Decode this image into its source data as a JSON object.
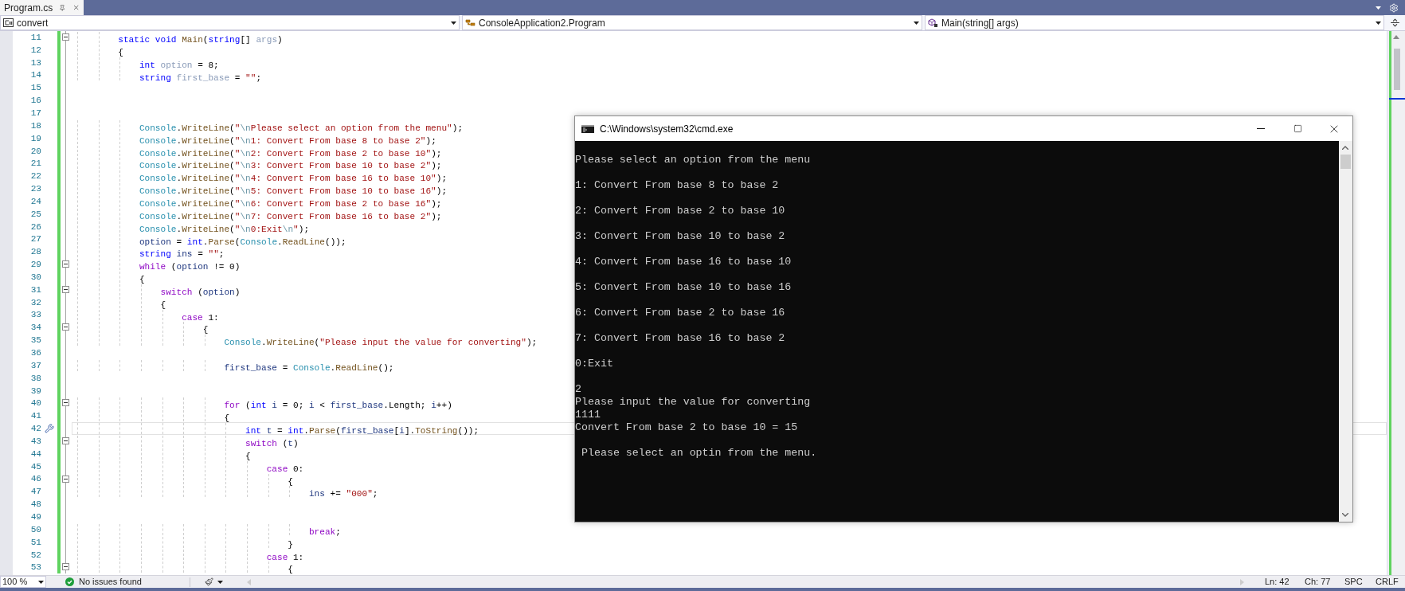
{
  "editor_tab": {
    "title": "Program.cs"
  },
  "nav_bar": {
    "project": "convert",
    "class": "ConsoleApplication2.Program",
    "member": "Main(string[] args)"
  },
  "code_lines": [
    {
      "number": "11",
      "changed": true,
      "fold": true,
      "current": false,
      "code": [
        {
          "text": "        static void ",
          "kind": "kw"
        },
        {
          "text": "Main",
          "kind": "method"
        },
        {
          "text": "(",
          "kind": "plain"
        },
        {
          "text": "string",
          "kind": "kw"
        },
        {
          "text": "[] ",
          "kind": "plain"
        },
        {
          "text": "args",
          "kind": "faded"
        },
        {
          "text": ")",
          "kind": "plain"
        }
      ]
    },
    {
      "number": "12",
      "changed": true,
      "fold": false,
      "current": false,
      "code": [
        {
          "text": "        {",
          "kind": "plain"
        }
      ]
    },
    {
      "number": "13",
      "changed": true,
      "fold": false,
      "current": false,
      "code": [
        {
          "text": "            int ",
          "kind": "kw"
        },
        {
          "text": "option",
          "kind": "faded"
        },
        {
          "text": " = 8;",
          "kind": "plain"
        }
      ]
    },
    {
      "number": "14",
      "changed": true,
      "fold": false,
      "current": false,
      "code": [
        {
          "text": "            string ",
          "kind": "kw"
        },
        {
          "text": "first_base",
          "kind": "faded"
        },
        {
          "text": " = ",
          "kind": "plain"
        },
        {
          "text": "\"\"",
          "kind": "str"
        },
        {
          "text": ";",
          "kind": "plain"
        }
      ]
    },
    {
      "number": "15",
      "changed": true,
      "fold": false,
      "current": false
    },
    {
      "number": "16",
      "changed": true,
      "fold": false,
      "current": false
    },
    {
      "number": "17",
      "changed": true,
      "fold": false,
      "current": false
    },
    {
      "number": "18",
      "changed": true,
      "fold": false,
      "current": false,
      "code": [
        {
          "text": "            Console",
          "kind": "type"
        },
        {
          "text": ".",
          "kind": "plain"
        },
        {
          "text": "WriteLine",
          "kind": "method"
        },
        {
          "text": "(",
          "kind": "plain"
        },
        {
          "text": "\"",
          "kind": "str"
        },
        {
          "text": "\\n",
          "kind": "esc"
        },
        {
          "text": "Please select an option from the menu\"",
          "kind": "str"
        },
        {
          "text": ");",
          "kind": "plain"
        }
      ]
    },
    {
      "number": "19",
      "changed": true,
      "fold": false,
      "current": false,
      "code": [
        {
          "text": "            Console",
          "kind": "type"
        },
        {
          "text": ".",
          "kind": "plain"
        },
        {
          "text": "WriteLine",
          "kind": "method"
        },
        {
          "text": "(",
          "kind": "plain"
        },
        {
          "text": "\"",
          "kind": "str"
        },
        {
          "text": "\\n",
          "kind": "esc"
        },
        {
          "text": "1: Convert From base 8 to base 2\"",
          "kind": "str"
        },
        {
          "text": ");",
          "kind": "plain"
        }
      ]
    },
    {
      "number": "20",
      "changed": true,
      "fold": false,
      "current": false,
      "code": [
        {
          "text": "            Console",
          "kind": "type"
        },
        {
          "text": ".",
          "kind": "plain"
        },
        {
          "text": "WriteLine",
          "kind": "method"
        },
        {
          "text": "(",
          "kind": "plain"
        },
        {
          "text": "\"",
          "kind": "str"
        },
        {
          "text": "\\n",
          "kind": "esc"
        },
        {
          "text": "2: Convert From base 2 to base 10\"",
          "kind": "str"
        },
        {
          "text": ");",
          "kind": "plain"
        }
      ]
    },
    {
      "number": "21",
      "changed": true,
      "fold": false,
      "current": false,
      "code": [
        {
          "text": "            Console",
          "kind": "type"
        },
        {
          "text": ".",
          "kind": "plain"
        },
        {
          "text": "WriteLine",
          "kind": "method"
        },
        {
          "text": "(",
          "kind": "plain"
        },
        {
          "text": "\"",
          "kind": "str"
        },
        {
          "text": "\\n",
          "kind": "esc"
        },
        {
          "text": "3: Convert From base 10 to base 2\"",
          "kind": "str"
        },
        {
          "text": ");",
          "kind": "plain"
        }
      ]
    },
    {
      "number": "22",
      "changed": true,
      "fold": false,
      "current": false,
      "code": [
        {
          "text": "            Console",
          "kind": "type"
        },
        {
          "text": ".",
          "kind": "plain"
        },
        {
          "text": "WriteLine",
          "kind": "method"
        },
        {
          "text": "(",
          "kind": "plain"
        },
        {
          "text": "\"",
          "kind": "str"
        },
        {
          "text": "\\n",
          "kind": "esc"
        },
        {
          "text": "4: Convert From base 16 to base 10\"",
          "kind": "str"
        },
        {
          "text": ");",
          "kind": "plain"
        }
      ]
    },
    {
      "number": "23",
      "changed": true,
      "fold": false,
      "current": false,
      "code": [
        {
          "text": "            Console",
          "kind": "type"
        },
        {
          "text": ".",
          "kind": "plain"
        },
        {
          "text": "WriteLine",
          "kind": "method"
        },
        {
          "text": "(",
          "kind": "plain"
        },
        {
          "text": "\"",
          "kind": "str"
        },
        {
          "text": "\\n",
          "kind": "esc"
        },
        {
          "text": "5: Convert From base 10 to base 16\"",
          "kind": "str"
        },
        {
          "text": ");",
          "kind": "plain"
        }
      ]
    },
    {
      "number": "24",
      "changed": true,
      "fold": false,
      "current": false,
      "code": [
        {
          "text": "            Console",
          "kind": "type"
        },
        {
          "text": ".",
          "kind": "plain"
        },
        {
          "text": "WriteLine",
          "kind": "method"
        },
        {
          "text": "(",
          "kind": "plain"
        },
        {
          "text": "\"",
          "kind": "str"
        },
        {
          "text": "\\n",
          "kind": "esc"
        },
        {
          "text": "6: Convert From base 2 to base 16\"",
          "kind": "str"
        },
        {
          "text": ");",
          "kind": "plain"
        }
      ]
    },
    {
      "number": "25",
      "changed": true,
      "fold": false,
      "current": false,
      "code": [
        {
          "text": "            Console",
          "kind": "type"
        },
        {
          "text": ".",
          "kind": "plain"
        },
        {
          "text": "WriteLine",
          "kind": "method"
        },
        {
          "text": "(",
          "kind": "plain"
        },
        {
          "text": "\"",
          "kind": "str"
        },
        {
          "text": "\\n",
          "kind": "esc"
        },
        {
          "text": "7: Convert From base 16 to base 2\"",
          "kind": "str"
        },
        {
          "text": ");",
          "kind": "plain"
        }
      ]
    },
    {
      "number": "26",
      "changed": true,
      "fold": false,
      "current": false,
      "code": [
        {
          "text": "            Console",
          "kind": "type"
        },
        {
          "text": ".",
          "kind": "plain"
        },
        {
          "text": "WriteLine",
          "kind": "method"
        },
        {
          "text": "(",
          "kind": "plain"
        },
        {
          "text": "\"",
          "kind": "str"
        },
        {
          "text": "\\n",
          "kind": "esc"
        },
        {
          "text": "0:Exit",
          "kind": "str"
        },
        {
          "text": "\\n",
          "kind": "esc"
        },
        {
          "text": "\"",
          "kind": "str"
        },
        {
          "text": ");",
          "kind": "plain"
        }
      ]
    },
    {
      "number": "27",
      "changed": true,
      "fold": false,
      "current": false,
      "code": [
        {
          "text": "            option",
          "kind": "local"
        },
        {
          "text": " = ",
          "kind": "plain"
        },
        {
          "text": "int",
          "kind": "kw"
        },
        {
          "text": ".",
          "kind": "plain"
        },
        {
          "text": "Parse",
          "kind": "method"
        },
        {
          "text": "(",
          "kind": "plain"
        },
        {
          "text": "Console",
          "kind": "type"
        },
        {
          "text": ".",
          "kind": "plain"
        },
        {
          "text": "ReadLine",
          "kind": "method"
        },
        {
          "text": "());",
          "kind": "plain"
        }
      ]
    },
    {
      "number": "28",
      "changed": true,
      "fold": false,
      "current": false,
      "code": [
        {
          "text": "            string ",
          "kind": "kw"
        },
        {
          "text": "ins",
          "kind": "local"
        },
        {
          "text": " = ",
          "kind": "plain"
        },
        {
          "text": "\"\"",
          "kind": "str"
        },
        {
          "text": ";",
          "kind": "plain"
        }
      ]
    },
    {
      "number": "29",
      "changed": true,
      "fold": true,
      "current": false,
      "code": [
        {
          "text": "            while",
          "kind": "ctl"
        },
        {
          "text": " (",
          "kind": "plain"
        },
        {
          "text": "option",
          "kind": "local"
        },
        {
          "text": " != 0)",
          "kind": "plain"
        }
      ]
    },
    {
      "number": "30",
      "changed": true,
      "fold": false,
      "current": false,
      "code": [
        {
          "text": "            {",
          "kind": "plain"
        }
      ]
    },
    {
      "number": "31",
      "changed": true,
      "fold": true,
      "current": false,
      "code": [
        {
          "text": "                switch",
          "kind": "ctl"
        },
        {
          "text": " (",
          "kind": "plain"
        },
        {
          "text": "option",
          "kind": "local"
        },
        {
          "text": ")",
          "kind": "plain"
        }
      ]
    },
    {
      "number": "32",
      "changed": true,
      "fold": false,
      "current": false,
      "code": [
        {
          "text": "                {",
          "kind": "plain"
        }
      ]
    },
    {
      "number": "33",
      "changed": true,
      "fold": false,
      "current": false,
      "code": [
        {
          "text": "                    case",
          "kind": "ctl"
        },
        {
          "text": " 1:",
          "kind": "plain"
        }
      ]
    },
    {
      "number": "34",
      "changed": true,
      "fold": true,
      "current": false,
      "code": [
        {
          "text": "                        {",
          "kind": "plain"
        }
      ]
    },
    {
      "number": "35",
      "changed": true,
      "fold": false,
      "current": false,
      "code": [
        {
          "text": "                            Console",
          "kind": "type"
        },
        {
          "text": ".",
          "kind": "plain"
        },
        {
          "text": "WriteLine",
          "kind": "method"
        },
        {
          "text": "(",
          "kind": "plain"
        },
        {
          "text": "\"Please input the value for converting\"",
          "kind": "str"
        },
        {
          "text": ");",
          "kind": "plain"
        }
      ]
    },
    {
      "number": "36",
      "changed": true,
      "fold": false,
      "current": false
    },
    {
      "number": "37",
      "changed": true,
      "fold": false,
      "current": false,
      "code": [
        {
          "text": "                            first_base",
          "kind": "local"
        },
        {
          "text": " = ",
          "kind": "plain"
        },
        {
          "text": "Console",
          "kind": "type"
        },
        {
          "text": ".",
          "kind": "plain"
        },
        {
          "text": "ReadLine",
          "kind": "method"
        },
        {
          "text": "();",
          "kind": "plain"
        }
      ]
    },
    {
      "number": "38",
      "changed": true,
      "fold": false,
      "current": false
    },
    {
      "number": "39",
      "changed": true,
      "fold": false,
      "current": false
    },
    {
      "number": "40",
      "changed": true,
      "fold": true,
      "current": false,
      "code": [
        {
          "text": "                            for",
          "kind": "ctl"
        },
        {
          "text": " (",
          "kind": "plain"
        },
        {
          "text": "int ",
          "kind": "kw"
        },
        {
          "text": "i",
          "kind": "local"
        },
        {
          "text": " = 0; ",
          "kind": "plain"
        },
        {
          "text": "i",
          "kind": "local"
        },
        {
          "text": " < ",
          "kind": "plain"
        },
        {
          "text": "first_base",
          "kind": "local"
        },
        {
          "text": ".Length; ",
          "kind": "plain"
        },
        {
          "text": "i",
          "kind": "local"
        },
        {
          "text": "++)",
          "kind": "plain"
        }
      ]
    },
    {
      "number": "41",
      "changed": true,
      "fold": false,
      "current": false,
      "code": [
        {
          "text": "                            {",
          "kind": "plain"
        }
      ]
    },
    {
      "number": "42",
      "changed": true,
      "fold": false,
      "current": true,
      "code": [
        {
          "text": "                                int ",
          "kind": "kw"
        },
        {
          "text": "t",
          "kind": "local"
        },
        {
          "text": " = ",
          "kind": "plain"
        },
        {
          "text": "int",
          "kind": "kw"
        },
        {
          "text": ".",
          "kind": "plain"
        },
        {
          "text": "Parse",
          "kind": "method"
        },
        {
          "text": "(",
          "kind": "plain"
        },
        {
          "text": "first_base",
          "kind": "local"
        },
        {
          "text": "[",
          "kind": "plain"
        },
        {
          "text": "i",
          "kind": "local"
        },
        {
          "text": "].",
          "kind": "plain"
        },
        {
          "text": "ToString",
          "kind": "method"
        },
        {
          "text": "());",
          "kind": "plain"
        }
      ]
    },
    {
      "number": "43",
      "changed": true,
      "fold": true,
      "current": false,
      "code": [
        {
          "text": "                                switch",
          "kind": "ctl"
        },
        {
          "text": " (",
          "kind": "plain"
        },
        {
          "text": "t",
          "kind": "local"
        },
        {
          "text": ")",
          "kind": "plain"
        }
      ]
    },
    {
      "number": "44",
      "changed": true,
      "fold": false,
      "current": false,
      "code": [
        {
          "text": "                                {",
          "kind": "plain"
        }
      ]
    },
    {
      "number": "45",
      "changed": true,
      "fold": false,
      "current": false,
      "code": [
        {
          "text": "                                    case",
          "kind": "ctl"
        },
        {
          "text": " 0:",
          "kind": "plain"
        }
      ]
    },
    {
      "number": "46",
      "changed": true,
      "fold": true,
      "current": false,
      "code": [
        {
          "text": "                                        {",
          "kind": "plain"
        }
      ]
    },
    {
      "number": "47",
      "changed": true,
      "fold": false,
      "current": false,
      "code": [
        {
          "text": "                                            ins",
          "kind": "local"
        },
        {
          "text": " += ",
          "kind": "plain"
        },
        {
          "text": "\"000\"",
          "kind": "str"
        },
        {
          "text": ";",
          "kind": "plain"
        }
      ]
    },
    {
      "number": "48",
      "changed": true,
      "fold": false,
      "current": false
    },
    {
      "number": "49",
      "changed": true,
      "fold": false,
      "current": false
    },
    {
      "number": "50",
      "changed": true,
      "fold": false,
      "current": false,
      "code": [
        {
          "text": "                                            break",
          "kind": "ctl"
        },
        {
          "text": ";",
          "kind": "plain"
        }
      ]
    },
    {
      "number": "51",
      "changed": true,
      "fold": false,
      "current": false,
      "code": [
        {
          "text": "                                        }",
          "kind": "plain"
        }
      ]
    },
    {
      "number": "52",
      "changed": true,
      "fold": false,
      "current": false,
      "code": [
        {
          "text": "                                    case",
          "kind": "ctl"
        },
        {
          "text": " 1:",
          "kind": "plain"
        }
      ]
    },
    {
      "number": "53",
      "changed": true,
      "fold": true,
      "current": false,
      "code": [
        {
          "text": "                                        {",
          "kind": "plain"
        }
      ]
    }
  ],
  "console_window": {
    "title": "C:\\Windows\\system32\\cmd.exe",
    "output_blocks": [
      [
        "Please select an option from the menu"
      ],
      [
        "1: Convert From base 8 to base 2"
      ],
      [
        "2: Convert From base 2 to base 10"
      ],
      [
        "3: Convert From base 10 to base 2"
      ],
      [
        "4: Convert From base 16 to base 10"
      ],
      [
        "5: Convert From base 10 to base 16"
      ],
      [
        "6: Convert From base 2 to base 16"
      ],
      [
        "7: Convert From base 16 to base 2"
      ],
      [
        "0:Exit"
      ],
      [
        "2",
        "Please input the value for converting",
        "1111",
        "Convert From base 2 to base 10 = 15"
      ],
      [
        " Please select an optin from the menu."
      ]
    ]
  },
  "status_bar": {
    "zoom": "100 %",
    "issues": "No issues found",
    "line": "Ln: 42",
    "column": "Ch: 77",
    "whitespace": "SPC",
    "line_ending": "CRLF"
  }
}
